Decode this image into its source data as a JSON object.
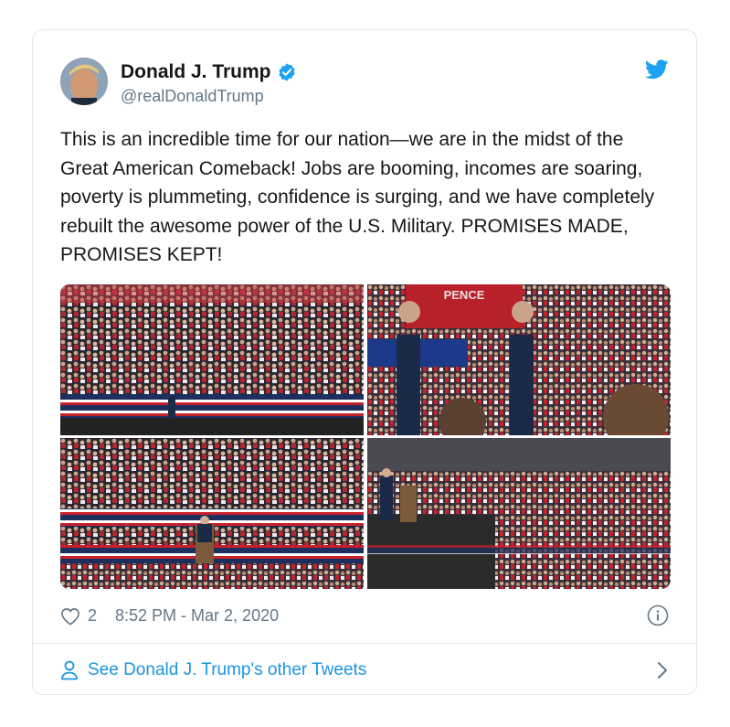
{
  "tweet": {
    "display_name": "Donald J. Trump",
    "handle": "@realDonaldTrump",
    "text": "This is an incredible time for our nation—we are in the midst of the Great American Comeback! Jobs are booming, incomes are soaring, poverty is plummeting, confidence is surging, and we have completely rebuilt the awesome power of the U.S. Military. PROMISES MADE, PROMISES KEPT!",
    "likes": "2",
    "timestamp": "8:52 PM - Mar 2, 2020",
    "media_sign_text": "PENCE"
  },
  "footer": {
    "more_tweets_label": "See Donald J. Trump's other Tweets"
  },
  "icons": {
    "verified": "verified-badge-icon",
    "bird": "twitter-bird-icon",
    "heart": "heart-icon",
    "info": "info-icon",
    "person": "person-icon",
    "chevron": "chevron-right-icon"
  },
  "colors": {
    "accent": "#1da1f2",
    "link": "#1b95e0",
    "muted": "#657786",
    "border": "#e1e8ed"
  }
}
